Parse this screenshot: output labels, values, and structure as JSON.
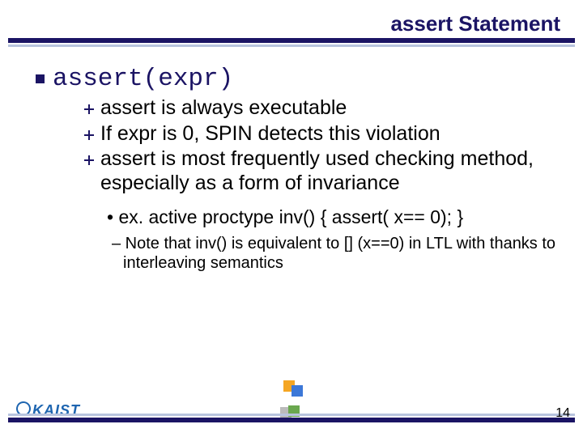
{
  "title": "assert Statement",
  "bullet1": "assert(expr)",
  "sub": {
    "a": "assert is always executable",
    "b": "If expr is 0, SPIN detects this violation",
    "c": "assert is most frequently used checking method, especially as a form of invariance"
  },
  "example": "• ex.  active proctype inv() { assert( x== 0); }",
  "note": "– Note that inv() is equivalent to [] (x==0) in LTL with thanks to interleaving semantics",
  "footer": {
    "brand": "KAIST",
    "page": "14"
  }
}
